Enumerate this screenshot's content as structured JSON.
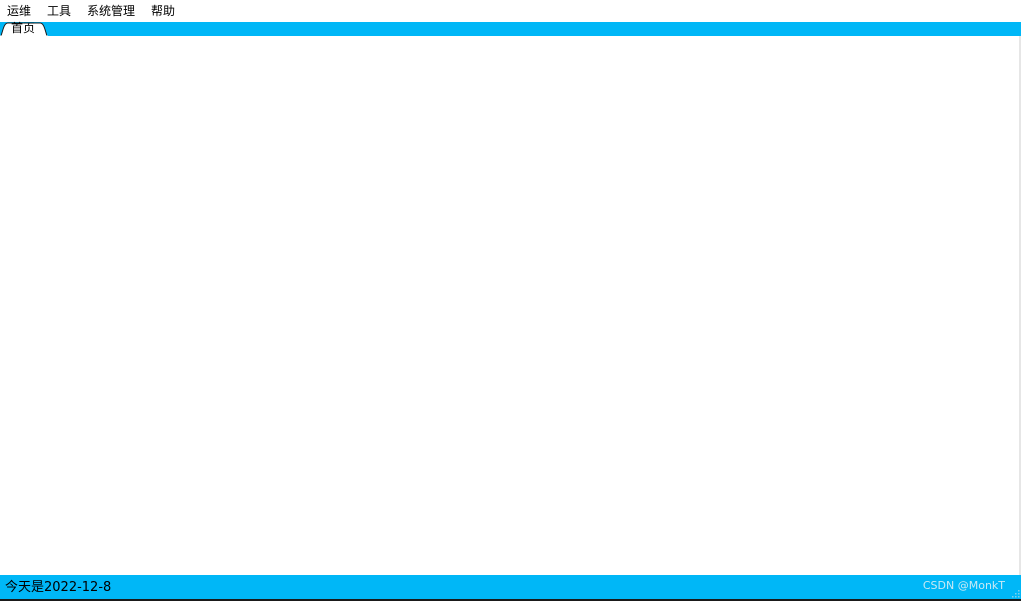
{
  "menubar": {
    "items": [
      {
        "label": "运维"
      },
      {
        "label": "工具"
      },
      {
        "label": "系统管理"
      },
      {
        "label": "帮助"
      }
    ]
  },
  "tabs": [
    {
      "label": "首页",
      "active": true
    }
  ],
  "statusbar": {
    "text": "今天是2022-12-8",
    "watermark": "CSDN @MonkT"
  },
  "colors": {
    "accent": "#00b7f7",
    "background": "#ffffff"
  },
  "icons": {
    "grip": "resize-grip-icon"
  }
}
